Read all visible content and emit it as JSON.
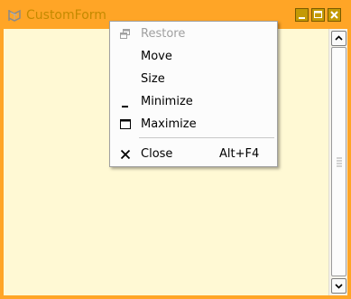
{
  "window": {
    "title": "CustomForm",
    "frame_color": "#FFA526",
    "client_color": "#FFF9D4",
    "title_color": "#C48A00",
    "caption_buttons": [
      {
        "name": "minimize",
        "icon": "minimize-icon"
      },
      {
        "name": "maximize",
        "icon": "maximize-icon"
      },
      {
        "name": "close",
        "icon": "close-icon"
      }
    ]
  },
  "system_menu": {
    "items": [
      {
        "label": "Restore",
        "enabled": false,
        "icon": "restore-icon"
      },
      {
        "label": "Move",
        "enabled": true
      },
      {
        "label": "Size",
        "enabled": true
      },
      {
        "label": "Minimize",
        "enabled": true,
        "icon": "minimize-icon"
      },
      {
        "label": "Maximize",
        "enabled": true,
        "icon": "maximize-icon"
      },
      {
        "label": "Close",
        "enabled": true,
        "icon": "close-icon",
        "shortcut": "Alt+F4"
      }
    ]
  }
}
